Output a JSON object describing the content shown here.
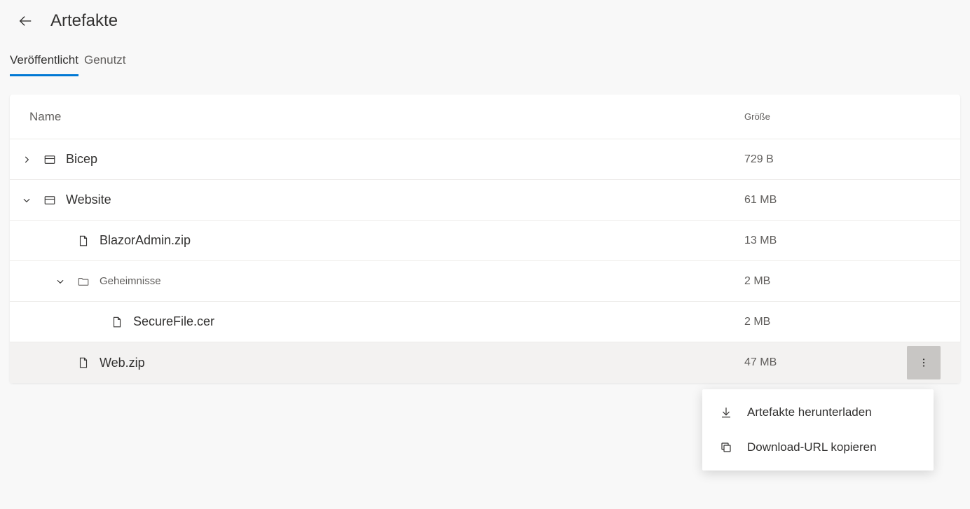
{
  "header": {
    "title": "Artefakte"
  },
  "tabs": {
    "published": "Veröffentlicht",
    "used": "Genutzt"
  },
  "table": {
    "columns": {
      "name": "Name",
      "size": "Größe"
    },
    "rows": [
      {
        "name": "Bicep",
        "size": "729 B",
        "type": "resource-group",
        "depth": 0,
        "expanded": false,
        "expandable": true
      },
      {
        "name": "Website",
        "size": "61 MB",
        "type": "resource-group",
        "depth": 0,
        "expanded": true,
        "expandable": true
      },
      {
        "name": "BlazorAdmin.zip",
        "size": "13 MB",
        "type": "file",
        "depth": 1,
        "expandable": false
      },
      {
        "name": "Geheimnisse",
        "size": "2 MB",
        "type": "folder",
        "depth": 1,
        "expanded": true,
        "expandable": true,
        "muted": true
      },
      {
        "name": "SecureFile.cer",
        "size": "2 MB",
        "type": "file",
        "depth": 2,
        "expandable": false
      },
      {
        "name": "Web.zip",
        "size": "47 MB",
        "type": "file",
        "depth": 1,
        "expandable": false,
        "hovered": true,
        "showActions": true
      }
    ]
  },
  "contextMenu": {
    "download": "Artefakte herunterladen",
    "copyUrl": "Download-URL kopieren"
  }
}
